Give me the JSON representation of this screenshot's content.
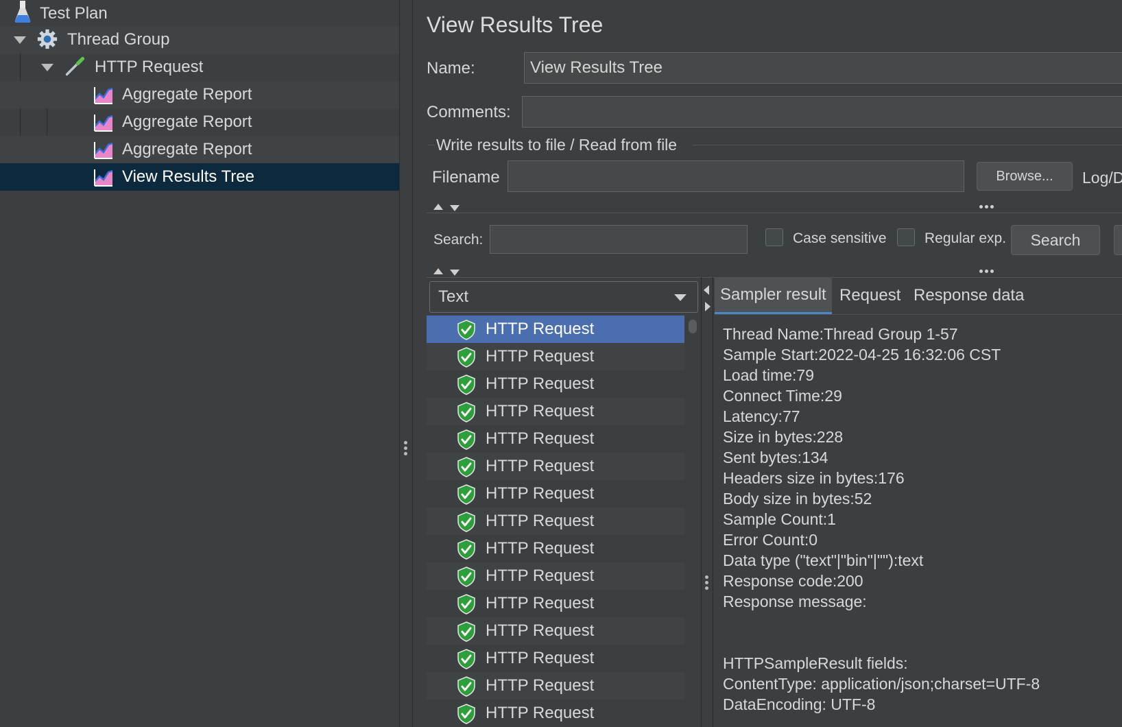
{
  "tree": {
    "items": [
      {
        "label": "Test Plan",
        "icon": "flask-icon"
      },
      {
        "label": "Thread Group",
        "icon": "gear-icon"
      },
      {
        "label": "HTTP Request",
        "icon": "pipette-icon"
      },
      {
        "label": "Aggregate Report",
        "icon": "chart-icon"
      },
      {
        "label": "Aggregate Report",
        "icon": "chart-icon"
      },
      {
        "label": "Aggregate Report",
        "icon": "chart-icon"
      },
      {
        "label": "View Results Tree",
        "icon": "chart-icon"
      }
    ]
  },
  "panel": {
    "title": "View Results Tree",
    "name_label": "Name:",
    "name_value": "View Results Tree",
    "comments_label": "Comments:",
    "comments_value": "",
    "file_section_title": "Write results to file / Read from file",
    "filename_label": "Filename",
    "filename_value": "",
    "browse_label": "Browse...",
    "log_label": "Log/D",
    "search_label": "Search:",
    "search_value": "",
    "case_sensitive_label": "Case sensitive",
    "regular_exp_label": "Regular exp.",
    "search_button_label": "Search"
  },
  "renderer": {
    "selected": "Text"
  },
  "results": {
    "items": [
      "HTTP Request",
      "HTTP Request",
      "HTTP Request",
      "HTTP Request",
      "HTTP Request",
      "HTTP Request",
      "HTTP Request",
      "HTTP Request",
      "HTTP Request",
      "HTTP Request",
      "HTTP Request",
      "HTTP Request",
      "HTTP Request",
      "HTTP Request",
      "HTTP Request"
    ]
  },
  "tabs": {
    "sampler_result": "Sampler result",
    "request": "Request",
    "response_data": "Response data"
  },
  "details": {
    "lines": [
      "Thread Name:Thread Group 1-57",
      "Sample Start:2022-04-25 16:32:06 CST",
      "Load time:79",
      "Connect Time:29",
      "Latency:77",
      "Size in bytes:228",
      "Sent bytes:134",
      "Headers size in bytes:176",
      "Body size in bytes:52",
      "Sample Count:1",
      "Error Count:0",
      "Data type (\"text\"|\"bin\"|\"\"):text",
      "Response code:200",
      "Response message:",
      "",
      "",
      "HTTPSampleResult fields:",
      "ContentType: application/json;charset=UTF-8",
      "DataEncoding: UTF-8"
    ]
  },
  "colors": {
    "background": "#3c3f41",
    "tree_selection": "#0d293e",
    "list_selection": "#4b6eaf",
    "tab_underline": "#4a88c7",
    "success_green": "#2e9e3a"
  }
}
